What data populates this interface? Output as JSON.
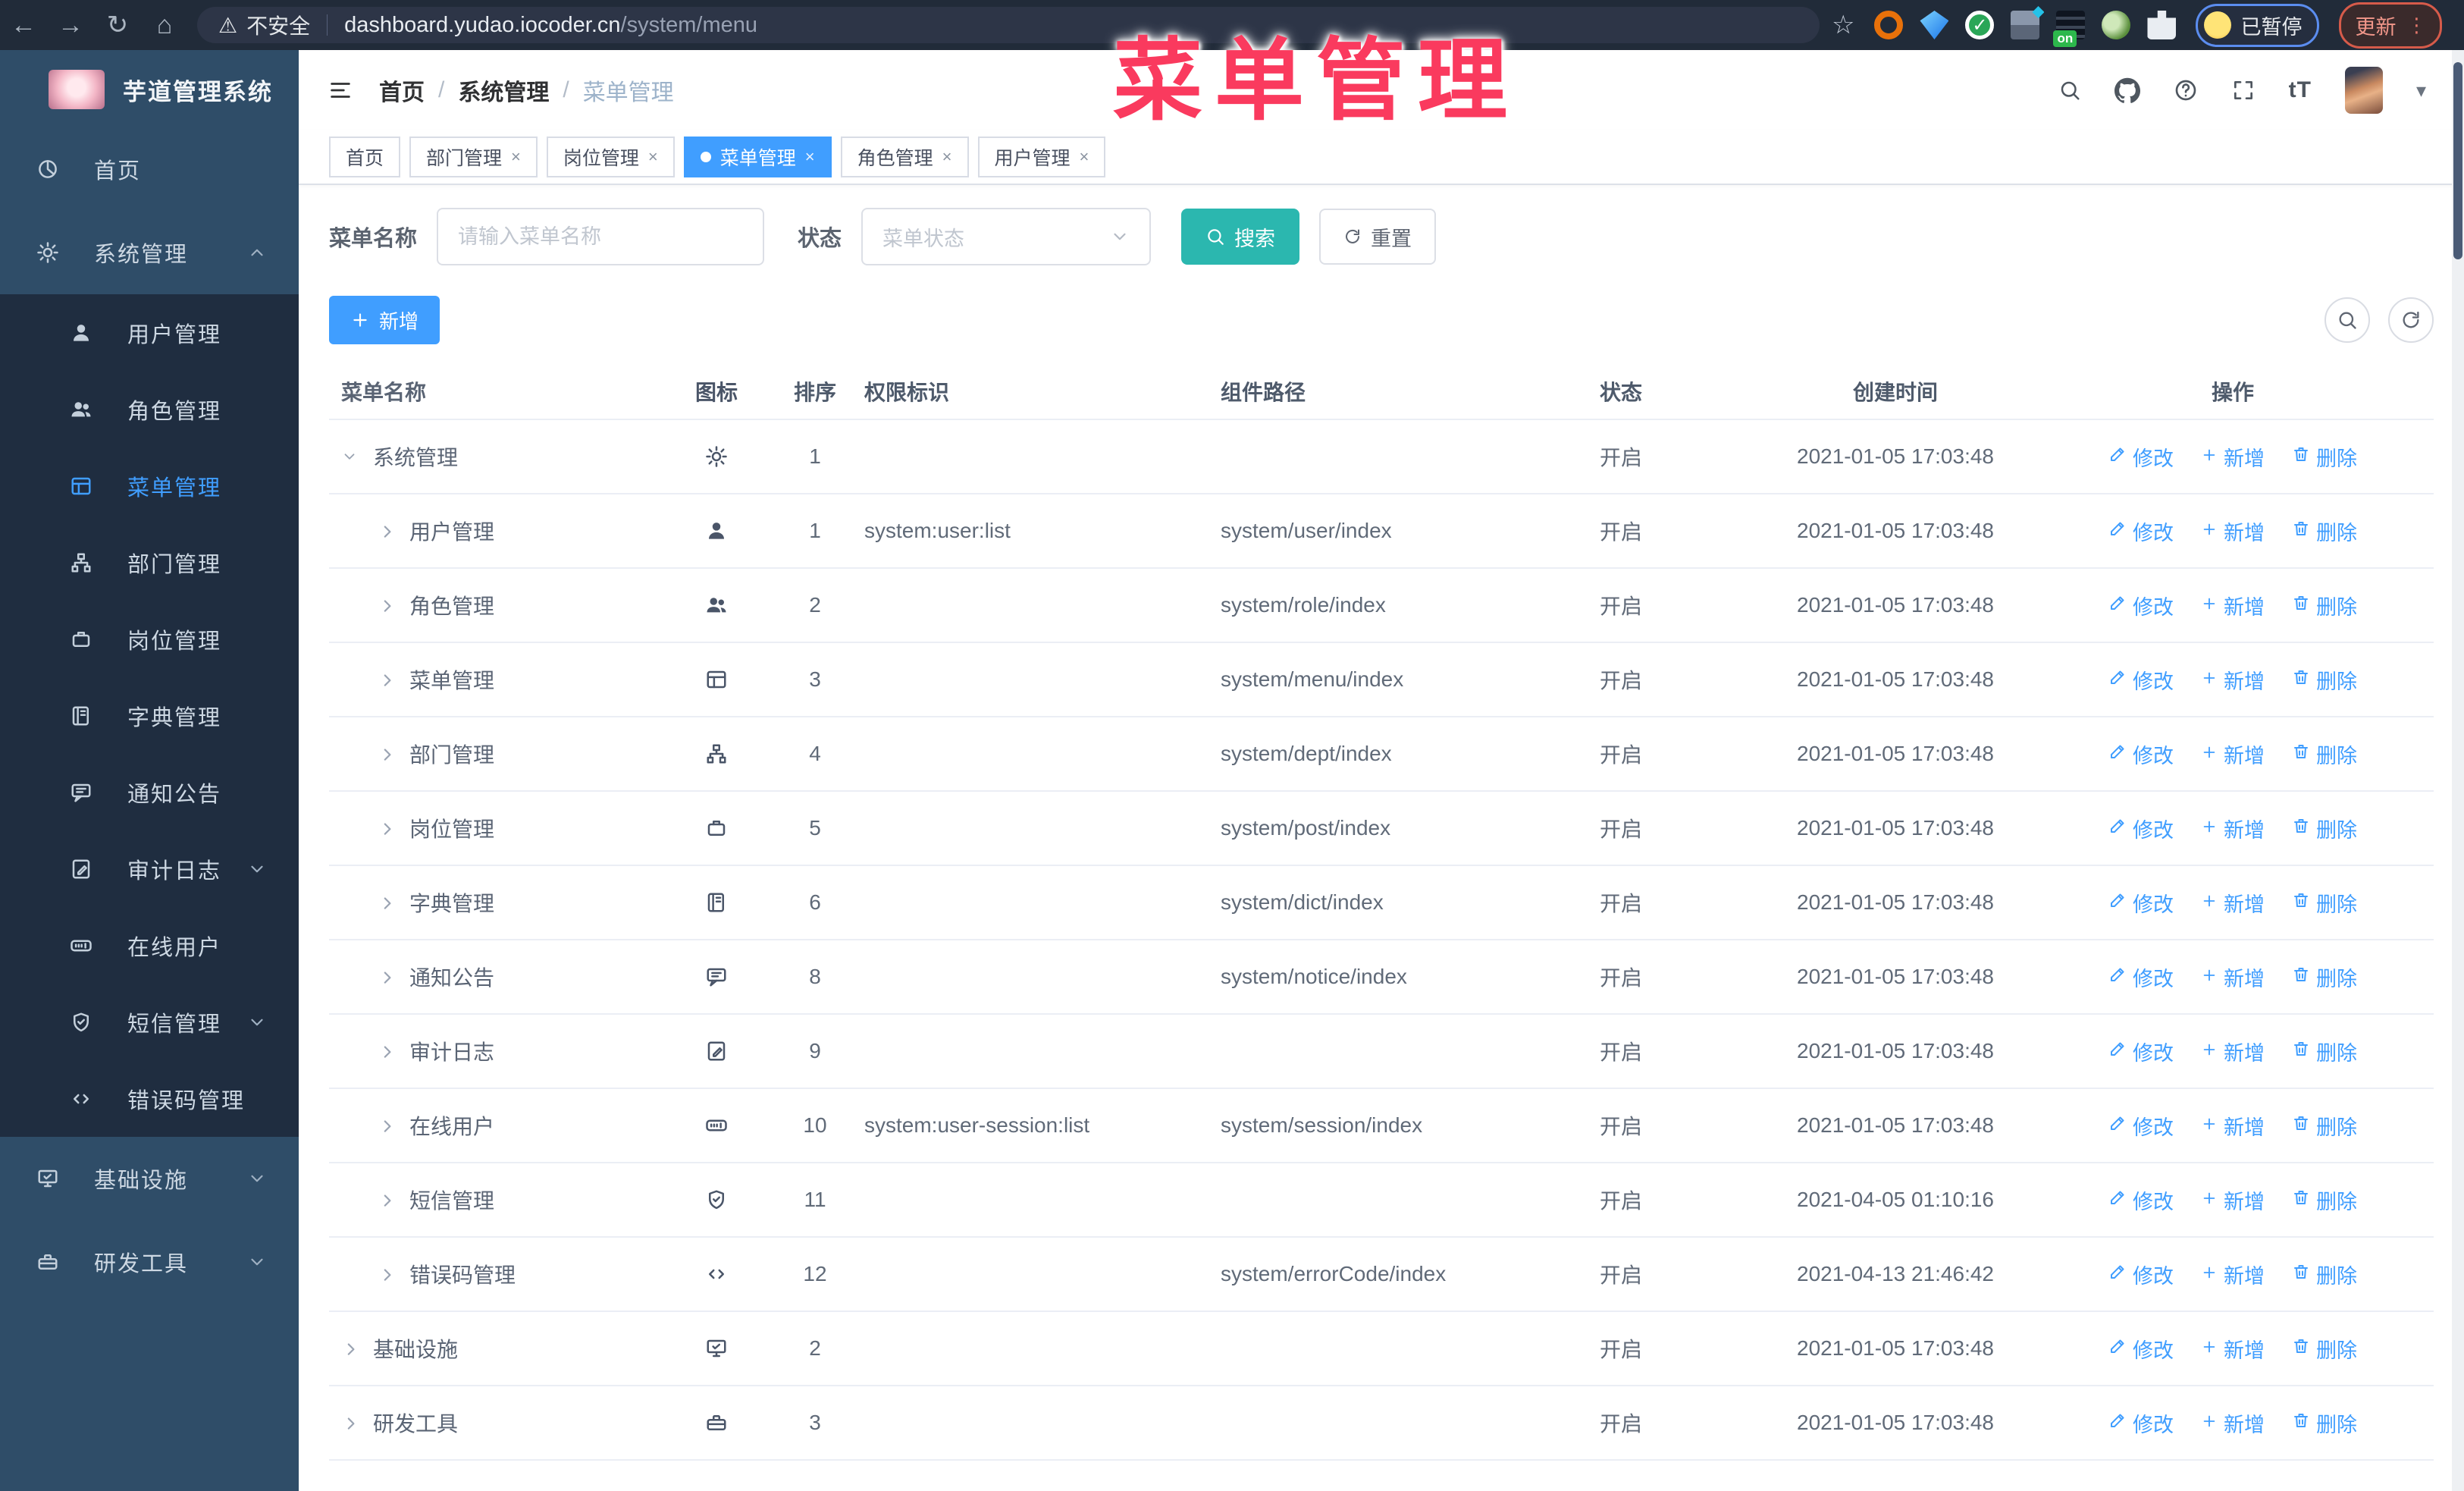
{
  "browser": {
    "security_label": "不安全",
    "url_host": "dashboard.yudao.iocoder.cn",
    "url_path": "/system/menu",
    "paused_badge": "已暂停",
    "update_button": "更新",
    "nav_icons": [
      "back-icon",
      "forward-icon",
      "reload-icon",
      "home-icon"
    ],
    "extensions": [
      "ext-orange",
      "ext-gem",
      "ext-check",
      "ext-blocks",
      "ext-bars",
      "ext-monkey",
      "ext-puzzle"
    ]
  },
  "overlay_title": "菜单管理",
  "sidebar": {
    "app_title": "芋道管理系统",
    "items": [
      {
        "label": "首页",
        "icon": "dashboard",
        "type": "top"
      },
      {
        "label": "系统管理",
        "icon": "gear",
        "type": "top",
        "chevron": "up"
      },
      {
        "label": "用户管理",
        "icon": "user",
        "type": "sub"
      },
      {
        "label": "角色管理",
        "icon": "users",
        "type": "sub"
      },
      {
        "label": "菜单管理",
        "icon": "menu",
        "type": "sub",
        "active": true
      },
      {
        "label": "部门管理",
        "icon": "tree",
        "type": "sub"
      },
      {
        "label": "岗位管理",
        "icon": "post",
        "type": "sub"
      },
      {
        "label": "字典管理",
        "icon": "dict",
        "type": "sub"
      },
      {
        "label": "通知公告",
        "icon": "message",
        "type": "sub"
      },
      {
        "label": "审计日志",
        "icon": "log",
        "type": "sub",
        "chevron": "down"
      },
      {
        "label": "在线用户",
        "icon": "online",
        "type": "sub"
      },
      {
        "label": "短信管理",
        "icon": "sms",
        "type": "sub",
        "chevron": "down"
      },
      {
        "label": "错误码管理",
        "icon": "code",
        "type": "sub"
      },
      {
        "label": "基础设施",
        "icon": "monitor",
        "type": "top",
        "chevron": "down"
      },
      {
        "label": "研发工具",
        "icon": "tool",
        "type": "top",
        "chevron": "down"
      }
    ]
  },
  "header": {
    "breadcrumb": [
      "首页",
      "系统管理",
      "菜单管理"
    ],
    "right_icons": [
      "search-icon",
      "github-icon",
      "help-icon",
      "fullscreen-icon",
      "text-size-icon",
      "avatar",
      "caret-down-icon"
    ],
    "text_size_label": "tT"
  },
  "tabs": [
    {
      "label": "首页",
      "closable": false,
      "active": false
    },
    {
      "label": "部门管理",
      "closable": true,
      "active": false
    },
    {
      "label": "岗位管理",
      "closable": true,
      "active": false
    },
    {
      "label": "菜单管理",
      "closable": true,
      "active": true
    },
    {
      "label": "角色管理",
      "closable": true,
      "active": false
    },
    {
      "label": "用户管理",
      "closable": true,
      "active": false
    }
  ],
  "filters": {
    "name_label": "菜单名称",
    "name_placeholder": "请输入菜单名称",
    "status_label": "状态",
    "status_placeholder": "菜单状态",
    "search_label": "搜索",
    "reset_label": "重置"
  },
  "toolbar": {
    "add_label": "新增"
  },
  "table": {
    "columns": [
      "菜单名称",
      "图标",
      "排序",
      "权限标识",
      "组件路径",
      "状态",
      "创建时间",
      "操作"
    ],
    "action_labels": {
      "edit": "修改",
      "add": "新增",
      "delete": "删除"
    },
    "rows": [
      {
        "name": "系统管理",
        "icon": "gear",
        "level": 0,
        "expanded": true,
        "sort": "1",
        "perm": "",
        "path": "",
        "status": "开启",
        "time": "2021-01-05 17:03:48"
      },
      {
        "name": "用户管理",
        "icon": "user",
        "level": 1,
        "expanded": false,
        "sort": "1",
        "perm": "system:user:list",
        "path": "system/user/index",
        "status": "开启",
        "time": "2021-01-05 17:03:48"
      },
      {
        "name": "角色管理",
        "icon": "users",
        "level": 1,
        "expanded": false,
        "sort": "2",
        "perm": "",
        "path": "system/role/index",
        "status": "开启",
        "time": "2021-01-05 17:03:48"
      },
      {
        "name": "菜单管理",
        "icon": "menu",
        "level": 1,
        "expanded": false,
        "sort": "3",
        "perm": "",
        "path": "system/menu/index",
        "status": "开启",
        "time": "2021-01-05 17:03:48"
      },
      {
        "name": "部门管理",
        "icon": "tree",
        "level": 1,
        "expanded": false,
        "sort": "4",
        "perm": "",
        "path": "system/dept/index",
        "status": "开启",
        "time": "2021-01-05 17:03:48"
      },
      {
        "name": "岗位管理",
        "icon": "post",
        "level": 1,
        "expanded": false,
        "sort": "5",
        "perm": "",
        "path": "system/post/index",
        "status": "开启",
        "time": "2021-01-05 17:03:48"
      },
      {
        "name": "字典管理",
        "icon": "dict",
        "level": 1,
        "expanded": false,
        "sort": "6",
        "perm": "",
        "path": "system/dict/index",
        "status": "开启",
        "time": "2021-01-05 17:03:48"
      },
      {
        "name": "通知公告",
        "icon": "message",
        "level": 1,
        "expanded": false,
        "sort": "8",
        "perm": "",
        "path": "system/notice/index",
        "status": "开启",
        "time": "2021-01-05 17:03:48"
      },
      {
        "name": "审计日志",
        "icon": "log",
        "level": 1,
        "expanded": false,
        "sort": "9",
        "perm": "",
        "path": "",
        "status": "开启",
        "time": "2021-01-05 17:03:48"
      },
      {
        "name": "在线用户",
        "icon": "online",
        "level": 1,
        "expanded": false,
        "sort": "10",
        "perm": "system:user-session:list",
        "path": "system/session/index",
        "status": "开启",
        "time": "2021-01-05 17:03:48"
      },
      {
        "name": "短信管理",
        "icon": "sms",
        "level": 1,
        "expanded": false,
        "sort": "11",
        "perm": "",
        "path": "",
        "status": "开启",
        "time": "2021-04-05 01:10:16"
      },
      {
        "name": "错误码管理",
        "icon": "code",
        "level": 1,
        "expanded": false,
        "sort": "12",
        "perm": "",
        "path": "system/errorCode/index",
        "status": "开启",
        "time": "2021-04-13 21:46:42"
      },
      {
        "name": "基础设施",
        "icon": "monitor",
        "level": 0,
        "expanded": false,
        "sort": "2",
        "perm": "",
        "path": "",
        "status": "开启",
        "time": "2021-01-05 17:03:48"
      },
      {
        "name": "研发工具",
        "icon": "tool",
        "level": 0,
        "expanded": false,
        "sort": "3",
        "perm": "",
        "path": "",
        "status": "开启",
        "time": "2021-01-05 17:03:48"
      }
    ]
  },
  "colors": {
    "primary": "#409eff",
    "search_button": "#2bb7af",
    "overlay_title": "#fa3a5e",
    "sidebar_bg": "#2f4d68",
    "sidebar_submenu_bg": "#1f2d40",
    "chrome_bg": "#212b39",
    "update_red": "#d65b4a",
    "paused_blue": "#5b8def"
  }
}
